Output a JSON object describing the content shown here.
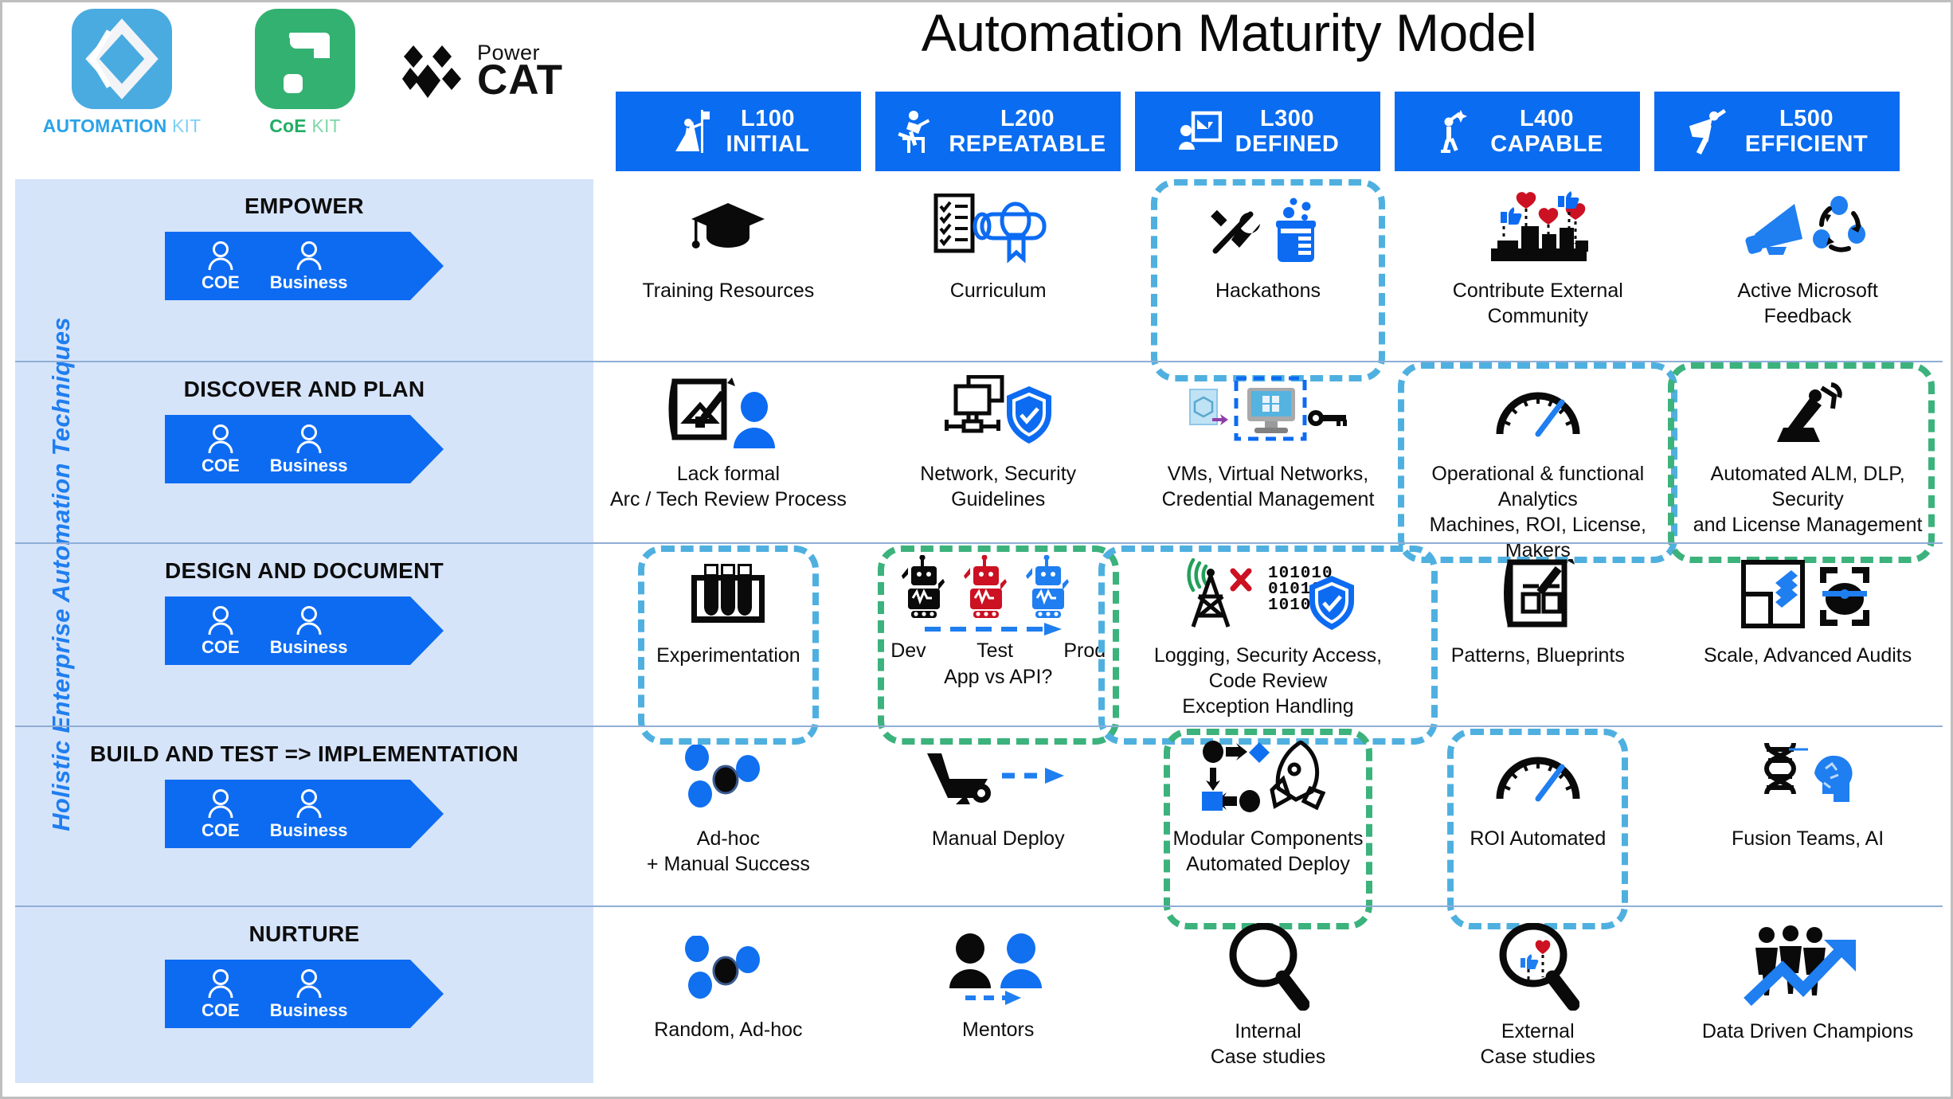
{
  "header": {
    "title": "Automation Maturity Model",
    "logos": [
      {
        "name": "automation-kit",
        "caption_bold": "AUTOMATION",
        "caption_light": "KIT"
      },
      {
        "name": "coe-kit",
        "caption_bold": "CoE",
        "caption_light": "KIT"
      }
    ],
    "powercat": {
      "line1": "Power",
      "line2": "CAT"
    }
  },
  "levels": [
    {
      "icon": "climber-icon",
      "code": "L100",
      "name": "INITIAL"
    },
    {
      "icon": "hurdler-icon",
      "code": "L200",
      "name": "REPEATABLE"
    },
    {
      "icon": "whiteboard-presenter-icon",
      "code": "L300",
      "name": "DEFINED"
    },
    {
      "icon": "star-reacher-icon",
      "code": "L400",
      "name": "CAPABLE"
    },
    {
      "icon": "cape-runner-icon",
      "code": "L500",
      "name": "EFFICIENT"
    }
  ],
  "side_label": "Holistic Enterprise Automation Techniques",
  "persona": {
    "coe": "COE",
    "business": "Business"
  },
  "colors": {
    "brand_blue": "#0d6bf2",
    "panel_blue": "#d6e4fa",
    "highlight_blue": "#4fb0e0",
    "highlight_green": "#3cb27c",
    "accent_red": "#cc1122",
    "divider": "#8faed6"
  },
  "rows": [
    {
      "title": "EMPOWER",
      "cells": [
        {
          "caption": "Training Resources",
          "icon": "graduation-cap-icon",
          "highlight": "none"
        },
        {
          "caption": "Curriculum",
          "icon": "checklist-diploma-icon",
          "highlight": "none"
        },
        {
          "caption": "Hackathons",
          "icon": "tools-beaker-icon",
          "highlight": "blue"
        },
        {
          "caption": "Contribute External\nCommunity",
          "icon": "city-likes-hearts-icon",
          "highlight": "none"
        },
        {
          "caption": "Active Microsoft\nFeedback",
          "icon": "megaphone-cycle-icon",
          "highlight": "none"
        }
      ]
    },
    {
      "title": "DISCOVER AND PLAN",
      "cells": [
        {
          "caption": "Lack  formal\nArc / Tech Review Process",
          "icon": "blueprint-person-icon",
          "highlight": "none"
        },
        {
          "caption": "Network, Security\nGuidelines",
          "icon": "network-shield-icon",
          "highlight": "none"
        },
        {
          "caption": "VMs, Virtual Networks,\nCredential Management",
          "icon": "vm-monitor-key-icon",
          "highlight": "inner-blue"
        },
        {
          "caption": "Operational & functional Analytics\nMachines, ROI, License, Makers",
          "icon": "gauge-icon",
          "highlight": "blue"
        },
        {
          "caption": "Automated ALM, DLP, Security\nand License Management",
          "icon": "robot-arm-icon",
          "highlight": "green"
        }
      ]
    },
    {
      "title": "DESIGN AND DOCUMENT",
      "cells": [
        {
          "caption": "Experimentation",
          "icon": "test-tubes-icon",
          "highlight": "blue"
        },
        {
          "caption": "App vs API?",
          "icon": "three-robots-icon",
          "highlight": "green",
          "sublabels": [
            "Dev",
            "Test",
            "Prod"
          ]
        },
        {
          "caption": "Logging, Security Access, Code Review\nException Handling",
          "icon": "tower-binary-shield-icon",
          "highlight": "blue"
        },
        {
          "caption": "Patterns, Blueprints",
          "icon": "blueprint-pencil-icon",
          "highlight": "none"
        },
        {
          "caption": "Scale, Advanced Audits",
          "icon": "scale-audit-icon",
          "highlight": "none"
        }
      ]
    },
    {
      "title": "BUILD AND TEST => IMPLEMENTATION",
      "cells": [
        {
          "caption": "Ad-hoc\n+ Manual Success",
          "icon": "scattered-dots-icon",
          "highlight": "none"
        },
        {
          "caption": "Manual Deploy",
          "icon": "wheelbarrow-arrow-icon",
          "highlight": "none"
        },
        {
          "caption": "Modular Components\nAutomated Deploy",
          "icon": "flowchart-rocket-icon",
          "highlight": "green"
        },
        {
          "caption": "ROI Automated",
          "icon": "gauge-icon",
          "highlight": "blue"
        },
        {
          "caption": "Fusion Teams, AI",
          "icon": "dna-brain-icon",
          "highlight": "none"
        }
      ]
    },
    {
      "title": "NURTURE",
      "cells": [
        {
          "caption": "Random, Ad-hoc",
          "icon": "scattered-dots-icon",
          "highlight": "none"
        },
        {
          "caption": "Mentors",
          "icon": "two-people-arrow-icon",
          "highlight": "none"
        },
        {
          "caption": "Internal\nCase studies",
          "icon": "magnifier-icon",
          "highlight": "none"
        },
        {
          "caption": "External\nCase studies",
          "icon": "magnifier-likes-icon",
          "highlight": "none"
        },
        {
          "caption": "Data Driven Champions",
          "icon": "group-growth-arrow-icon",
          "highlight": "none"
        }
      ]
    }
  ]
}
